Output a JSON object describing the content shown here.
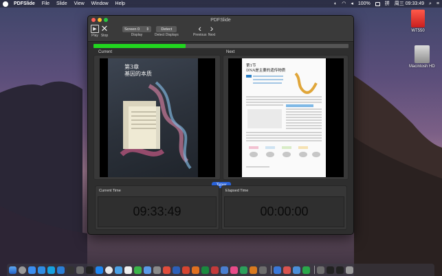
{
  "menubar": {
    "app_name": "PDFSlide",
    "items": [
      "File",
      "Slide",
      "View",
      "Window",
      "Help"
    ],
    "battery": "100%",
    "input_method": "拼",
    "clock": "周三 09:33:49"
  },
  "desktop": {
    "icons": [
      {
        "label": "WT550"
      },
      {
        "label": "Macintosh HD"
      }
    ]
  },
  "window": {
    "title": "PDFSlide",
    "toolbar": {
      "play_label": "Play",
      "stop_label": "Stop",
      "screen_value": "Screen 0",
      "display_label": "Display",
      "detect_button": "Detect",
      "detect_label": "Detect Displays",
      "previous_label": "Previous",
      "next_label": "Next"
    },
    "progress": 0.36,
    "panels": {
      "current_label": "Current",
      "next_label": "Next"
    },
    "current_slide": {
      "chapter": "第3章",
      "title": "基因的本质"
    },
    "next_slide": {
      "section": "第1节",
      "title": "DNA是主要的遗传物质"
    },
    "timer": {
      "tab_label": "Timer",
      "current_caption": "Current Time",
      "current_value": "09:33:49",
      "elapsed_caption": "Elapsed Time",
      "elapsed_value": "00:00:00"
    }
  },
  "colors": {
    "progress": "#21d61f",
    "timer_tab": "#2962d9"
  }
}
